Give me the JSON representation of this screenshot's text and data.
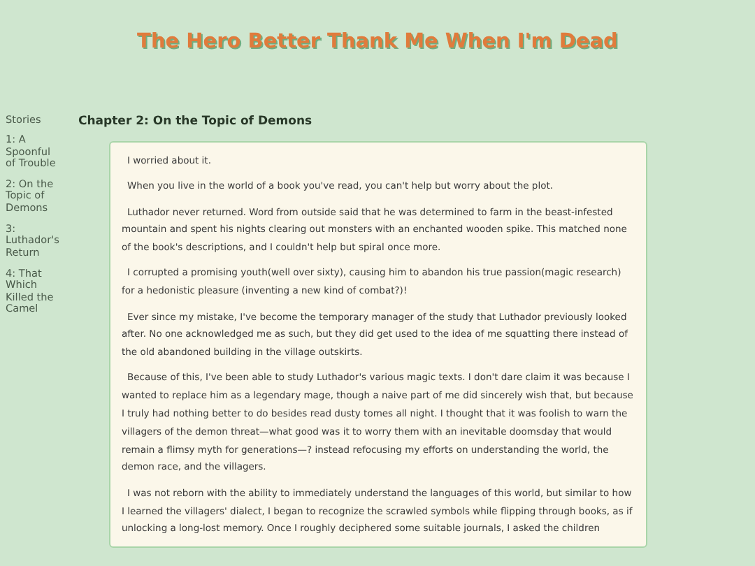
{
  "site_title": "The Hero Better Thank Me When I'm Dead",
  "sidebar": {
    "heading": "Stories",
    "items": [
      {
        "label": "1: A Spoonful of Trouble"
      },
      {
        "label": "2: On the Topic of Demons"
      },
      {
        "label": "3: Luthador's Return"
      },
      {
        "label": "4: That Which Killed the Camel"
      }
    ]
  },
  "chapter": {
    "title": "Chapter 2: On the Topic of Demons",
    "paragraphs": [
      "I worried about it.",
      "When you live in the world of a book you've read, you can't help but worry about the plot.",
      "Luthador never returned. Word from outside said that he was determined to farm in the beast-infested mountain and spent his nights clearing out monsters with an enchanted wooden spike. This matched none of the book's descriptions, and I couldn't help but spiral once more.",
      "I corrupted a promising youth(well over sixty), causing him to abandon his true passion(magic research) for a hedonistic pleasure (inventing a new kind of combat?)!",
      "Ever since my mistake, I've become the temporary manager of the study that Luthador previously looked after. No one acknowledged me as such, but they did get used to the idea of me squatting there instead of the old abandoned building in the village outskirts.",
      "Because of this, I've been able to study Luthador's various magic texts. I don't dare claim it was because I wanted to replace him as a legendary mage, though a naive part of me did sincerely wish that, but because I truly had nothing better to do besides read dusty tomes all night. I thought that it was foolish to warn the villagers of the demon threat—what good was it to worry them with an inevitable doomsday that would remain a flimsy myth for generations—? instead refocusing my efforts on understanding the world, the demon race, and the villagers.",
      "I was not reborn with the ability to immediately understand the languages of this world, but similar to how I learned the villagers' dialect, I began to recognize the scrawled symbols while flipping through books, as if unlocking a long-lost memory. Once I roughly deciphered some suitable journals, I asked the children"
    ]
  }
}
